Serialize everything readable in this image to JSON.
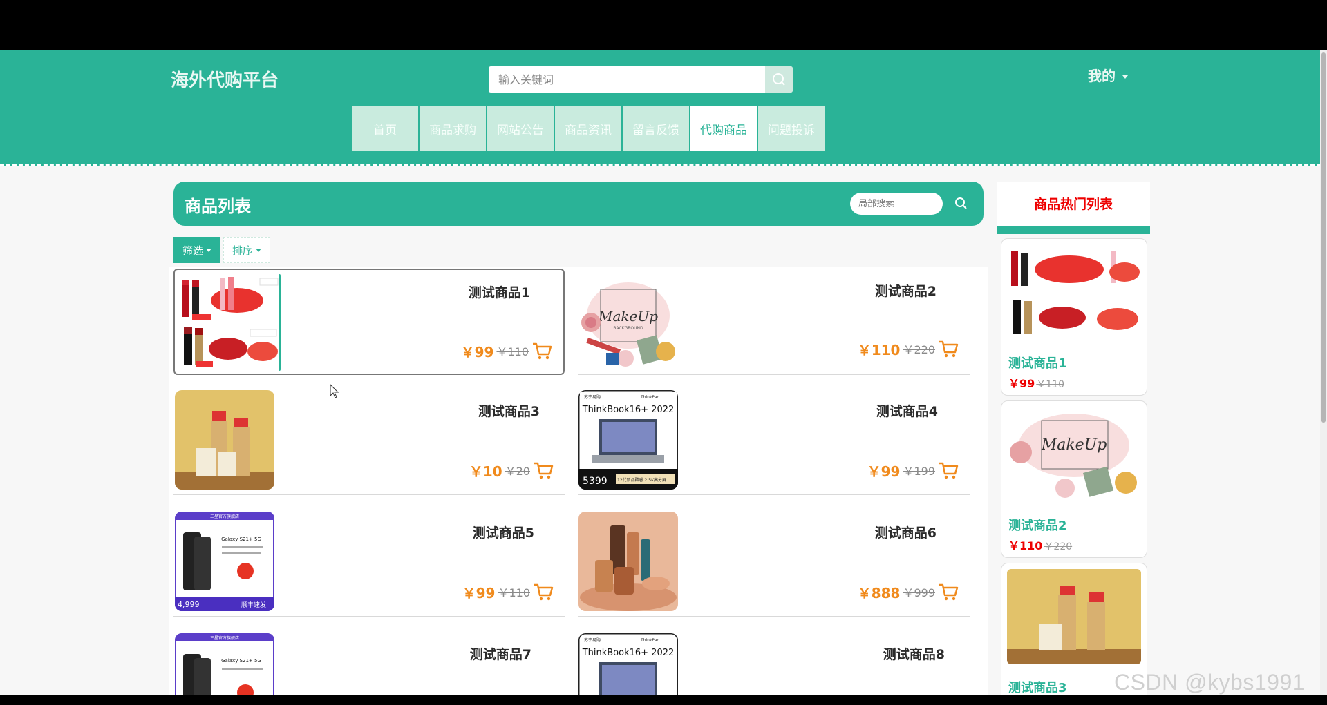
{
  "header": {
    "logo": "海外代购平台",
    "search_placeholder": "输入关键词",
    "user_menu": "我的",
    "nav": [
      "首页",
      "商品求购",
      "网站公告",
      "商品资讯",
      "留言反馈",
      "代购商品",
      "问题投诉"
    ],
    "active_nav": "代购商品"
  },
  "main": {
    "title": "商品列表",
    "local_search_placeholder": "局部搜索",
    "filter_label": "筛选",
    "sort_label": "排序"
  },
  "products": [
    {
      "name": "测试商品1",
      "price": "￥99",
      "orig": "￥110",
      "image": "lipstick-lips-image"
    },
    {
      "name": "测试商品2",
      "price": "￥110",
      "orig": "￥220",
      "image": "makeup-background-image"
    },
    {
      "name": "测试商品3",
      "price": "￥10",
      "orig": "￥20",
      "image": "ysl-lipstick-image"
    },
    {
      "name": "测试商品4",
      "price": "￥99",
      "orig": "￥199",
      "image": "thinkbook-laptop-image"
    },
    {
      "name": "测试商品5",
      "price": "￥99",
      "orig": "￥110",
      "image": "galaxy-phone-image"
    },
    {
      "name": "测试商品6",
      "price": "￥888",
      "orig": "￥999",
      "image": "cosmetics-bottles-image"
    },
    {
      "name": "测试商品7",
      "price": "",
      "orig": "",
      "image": "galaxy-phone-image"
    },
    {
      "name": "测试商品8",
      "price": "",
      "orig": "",
      "image": "thinkbook-laptop-image"
    }
  ],
  "image_text": {
    "thinkbook_title": "ThinkBook16+ 2022",
    "thinkbook_price": "5399",
    "thinkbook_tag": "12代新品酷睿 2.5K高分屏",
    "thinkbook_brand_left": "苏宁易购",
    "thinkbook_brand_right": "ThinkPad",
    "galaxy_banner": "三星官方旗舰店",
    "galaxy_model": "Galaxy S21+ 5G",
    "galaxy_price": "4,999",
    "galaxy_ship": "顺丰速发",
    "makeup_title": "MakeUp",
    "makeup_sub": "BACKGROUND"
  },
  "sidebar": {
    "title": "商品热门列表",
    "items": [
      {
        "name": "测试商品1",
        "price": "￥99",
        "orig": "￥110",
        "image": "lipstick-lips-image"
      },
      {
        "name": "测试商品2",
        "price": "￥110",
        "orig": "￥220",
        "image": "makeup-background-image"
      },
      {
        "name": "测试商品3",
        "price": "",
        "orig": "",
        "image": "ysl-lipstick-image"
      }
    ]
  },
  "watermark": "CSDN @kybs1991",
  "colors": {
    "primary": "#2ab397",
    "price": "#f08a1c",
    "hot_title": "#ee0000"
  }
}
